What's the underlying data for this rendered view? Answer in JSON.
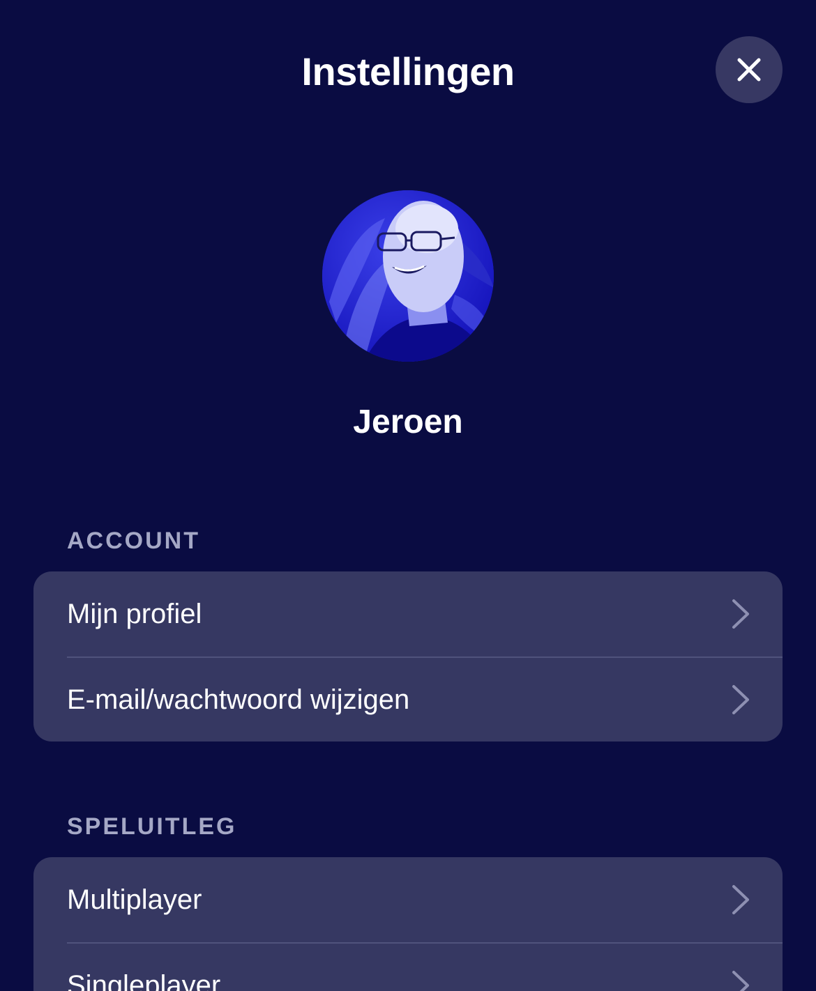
{
  "header": {
    "title": "Instellingen",
    "close_icon": "close-icon"
  },
  "profile": {
    "name": "Jeroen",
    "avatar": "profile-photo"
  },
  "sections": [
    {
      "label": "ACCOUNT",
      "items": [
        {
          "label": "Mijn profiel"
        },
        {
          "label": "E-mail/wachtwoord wijzigen"
        }
      ]
    },
    {
      "label": "SPELUITLEG",
      "items": [
        {
          "label": "Multiplayer"
        },
        {
          "label": "Singleplayer"
        }
      ]
    }
  ],
  "colors": {
    "background": "#0a0c42",
    "card": "#363862",
    "section_label": "#a5a8c6",
    "accent_blue": "#1b1fd6"
  }
}
